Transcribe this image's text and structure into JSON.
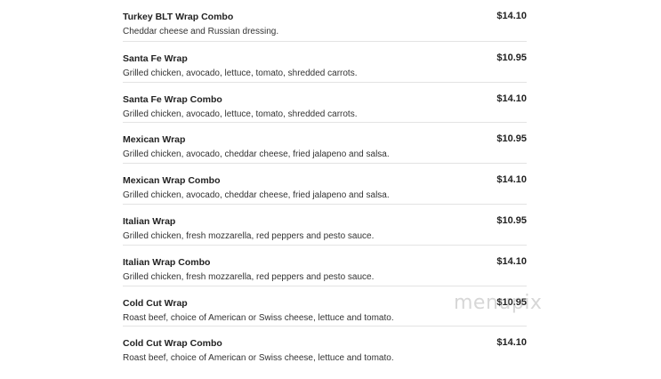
{
  "menu": {
    "items": [
      {
        "name": "Turkey BLT Wrap Combo",
        "price": "$14.10",
        "description": "Cheddar cheese and Russian dressing."
      },
      {
        "name": "Santa Fe Wrap",
        "price": "$10.95",
        "description": "Grilled chicken, avocado, lettuce, tomato, shredded carrots."
      },
      {
        "name": "Santa Fe Wrap Combo",
        "price": "$14.10",
        "description": "Grilled chicken, avocado, lettuce, tomato, shredded carrots."
      },
      {
        "name": "Mexican Wrap",
        "price": "$10.95",
        "description": "Grilled chicken, avocado, cheddar cheese, fried jalapeno and salsa."
      },
      {
        "name": "Mexican Wrap Combo",
        "price": "$14.10",
        "description": "Grilled chicken, avocado, cheddar cheese, fried jalapeno and salsa."
      },
      {
        "name": "Italian Wrap",
        "price": "$10.95",
        "description": "Grilled chicken, fresh mozzarella, red peppers and pesto sauce."
      },
      {
        "name": "Italian Wrap Combo",
        "price": "$14.10",
        "description": "Grilled chicken, fresh mozzarella, red peppers and pesto sauce."
      },
      {
        "name": "Cold Cut Wrap",
        "price": "$10.95",
        "description": "Roast beef, choice of American or Swiss cheese, lettuce and tomato."
      },
      {
        "name": "Cold Cut Wrap Combo",
        "price": "$14.10",
        "description": "Roast beef, choice of American or Swiss cheese, lettuce and tomato."
      }
    ]
  },
  "watermark": {
    "text": "menupix"
  }
}
